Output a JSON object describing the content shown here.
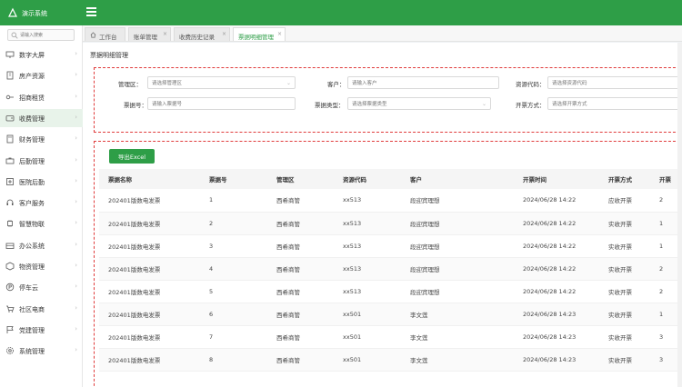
{
  "app": {
    "title": "演示系统"
  },
  "sidebar": {
    "search_placeholder": "请输入搜索",
    "items": [
      {
        "label": "数字大屏",
        "icon": "monitor-icon"
      },
      {
        "label": "房产资源",
        "icon": "building-icon"
      },
      {
        "label": "招商租赁",
        "icon": "key-icon"
      },
      {
        "label": "收费管理",
        "icon": "wallet-icon",
        "active": true
      },
      {
        "label": "财务管理",
        "icon": "calculator-icon"
      },
      {
        "label": "后勤管理",
        "icon": "toolbox-icon"
      },
      {
        "label": "医院后勤",
        "icon": "hospital-icon"
      },
      {
        "label": "客户服务",
        "icon": "headset-icon"
      },
      {
        "label": "智慧物联",
        "icon": "chip-icon"
      },
      {
        "label": "办公系统",
        "icon": "briefcase-icon"
      },
      {
        "label": "物资管理",
        "icon": "box-icon"
      },
      {
        "label": "停车云",
        "icon": "parking-icon"
      },
      {
        "label": "社区电商",
        "icon": "cart-icon"
      },
      {
        "label": "党建管理",
        "icon": "flag-icon"
      },
      {
        "label": "系统管理",
        "icon": "gear-icon"
      }
    ]
  },
  "tabs": [
    {
      "label": "工作台",
      "home": true
    },
    {
      "label": "账单管理",
      "closable": true
    },
    {
      "label": "收费历史记录",
      "closable": true
    },
    {
      "label": "票据明细管理",
      "closable": true,
      "active": true
    }
  ],
  "page": {
    "title": "票据明细管理"
  },
  "filters": {
    "mgmt_area": {
      "label": "管理区：",
      "placeholder": "请选择管理区"
    },
    "customer": {
      "label": "客户：",
      "placeholder": "请输入客户"
    },
    "resource_code": {
      "label": "资源代码：",
      "placeholder": "请选择资源代码"
    },
    "ticket_no": {
      "label": "票据号：",
      "placeholder": "请输入票据号"
    },
    "ticket_type": {
      "label": "票据类型：",
      "placeholder": "请选择票据类型"
    },
    "invoice_method": {
      "label": "开票方式：",
      "placeholder": "请选择开票方式"
    }
  },
  "toolbar": {
    "export_label": "导出Excel"
  },
  "table": {
    "columns": [
      "票据名称",
      "票据号",
      "管理区",
      "资源代码",
      "客户",
      "开票时间",
      "开票方式",
      "开票"
    ],
    "rows": [
      [
        "202401版数电发票",
        "1",
        "西希商管",
        "xx513",
        "段迎宾理想",
        "2024/06/28 14:22",
        "应收开票",
        "2"
      ],
      [
        "202401版数电发票",
        "2",
        "西希商管",
        "xx513",
        "段迎宾理想",
        "2024/06/28 14:22",
        "实收开票",
        "1"
      ],
      [
        "202401版数电发票",
        "3",
        "西希商管",
        "xx513",
        "段迎宾理想",
        "2024/06/28 14:22",
        "实收开票",
        "1"
      ],
      [
        "202401版数电发票",
        "4",
        "西希商管",
        "xx513",
        "段迎宾理想",
        "2024/06/28 14:22",
        "实收开票",
        "2"
      ],
      [
        "202401版数电发票",
        "5",
        "西希商管",
        "xx513",
        "段迎宾理想",
        "2024/06/28 14:22",
        "实收开票",
        "2"
      ],
      [
        "202401版数电发票",
        "6",
        "西希商管",
        "xx501",
        "李文莲",
        "2024/06/28 14:23",
        "实收开票",
        "1"
      ],
      [
        "202401版数电发票",
        "7",
        "西希商管",
        "xx501",
        "李文莲",
        "2024/06/28 14:23",
        "实收开票",
        "3"
      ],
      [
        "202401版数电发票",
        "8",
        "西希商管",
        "xx501",
        "李文莲",
        "2024/06/28 14:23",
        "实收开票",
        "3"
      ]
    ]
  },
  "colors": {
    "brand": "#2e9e47",
    "highlight_border": "#e03b3b"
  }
}
